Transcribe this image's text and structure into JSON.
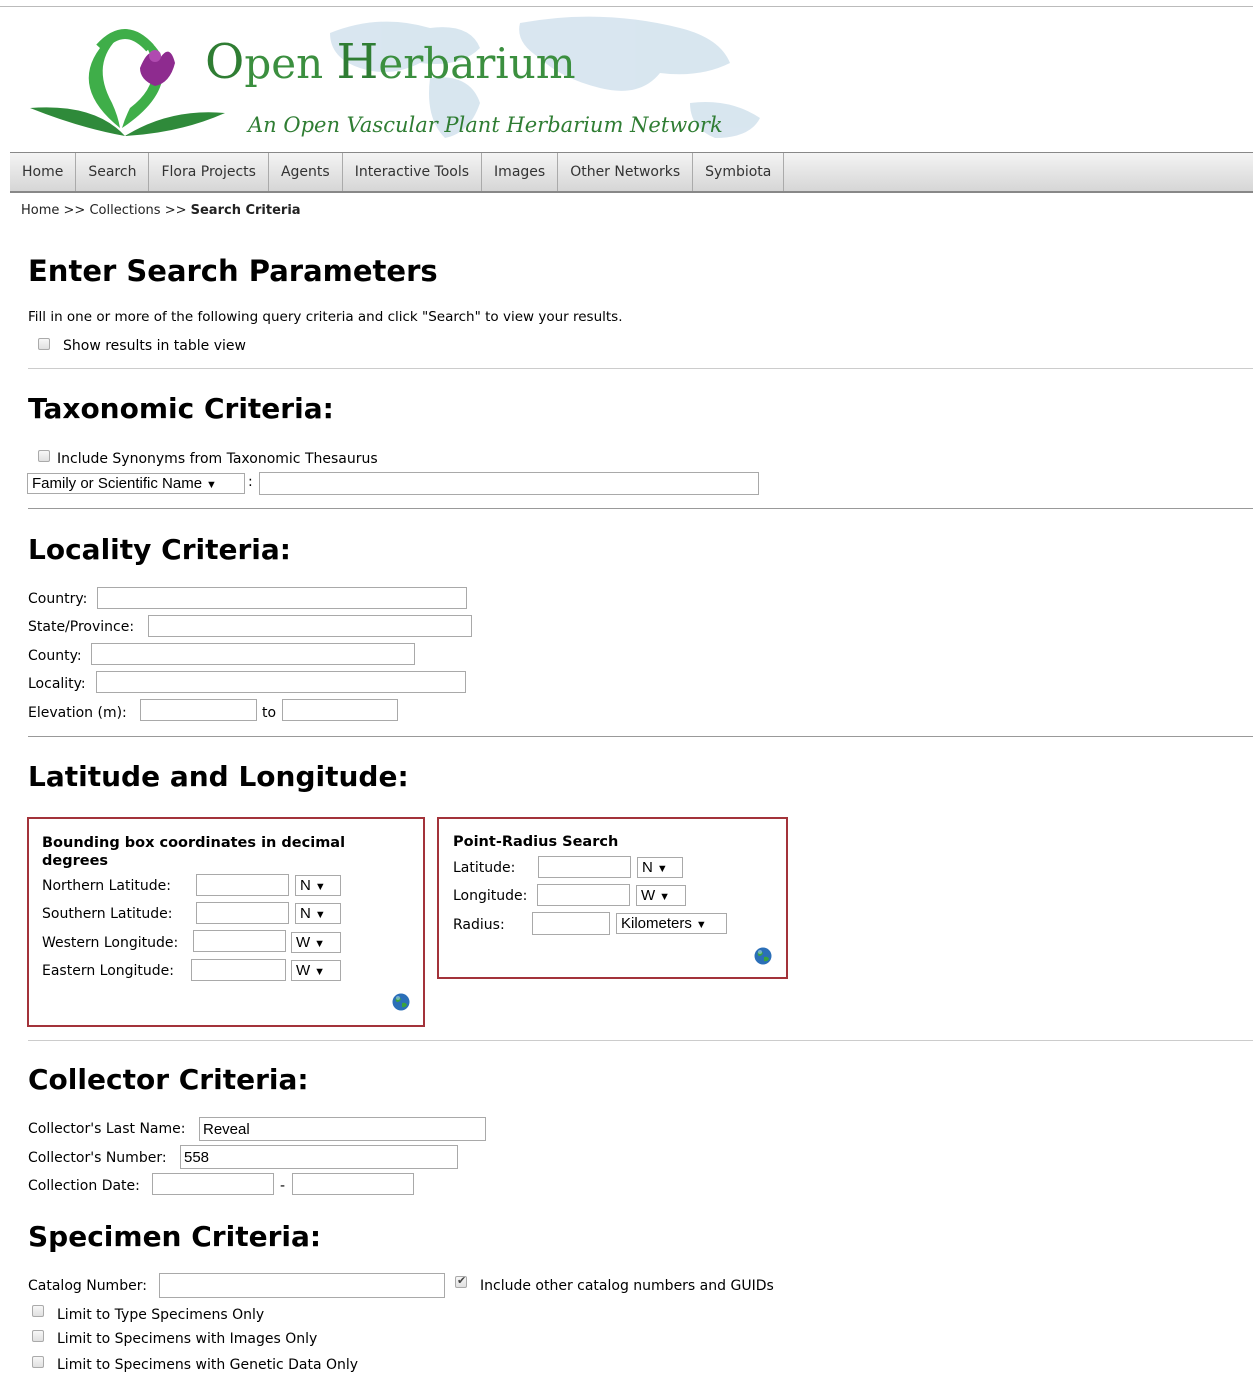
{
  "brand": {
    "title_o": "O",
    "title_rest1": "pen ",
    "title_h": "H",
    "title_rest2": "erbarium",
    "subtitle": "An Open Vascular Plant Herbarium Network"
  },
  "nav": [
    "Home",
    "Search",
    "Flora Projects",
    "Agents",
    "Interactive Tools",
    "Images",
    "Other Networks",
    "Symbiota"
  ],
  "breadcrumb": {
    "home": "Home",
    "sep": ">>",
    "collections": "Collections",
    "current": "Search Criteria"
  },
  "page_title": "Enter Search Parameters",
  "intro": "Fill in one or more of the following query criteria and click \"Search\" to view your results.",
  "table_view_label": "Show results in table view",
  "taxonomic": {
    "heading": "Taxonomic Criteria:",
    "synonyms_label": "Include Synonyms from Taxonomic Thesaurus",
    "type_select": "Family or Scientific Name",
    "colon": ":",
    "taxa_value": ""
  },
  "locality": {
    "heading": "Locality Criteria:",
    "country_label": "Country:",
    "state_label": "State/Province:",
    "county_label": "County:",
    "locality_label": "Locality:",
    "elevation_label": "Elevation (m):",
    "to_label": "to"
  },
  "latlong": {
    "heading": "Latitude and Longitude:",
    "bbox_title": "Bounding box coordinates in decimal degrees",
    "north_label": "Northern Latitude:",
    "south_label": "Southern Latitude:",
    "west_label": "Western Longitude:",
    "east_label": "Eastern Longitude:",
    "north_dir": "N",
    "south_dir": "N",
    "west_dir": "W",
    "east_dir": "W",
    "point_title": "Point-Radius Search",
    "lat_label": "Latitude:",
    "lng_label": "Longitude:",
    "radius_label": "Radius:",
    "lat_dir": "N",
    "lng_dir": "W",
    "radius_units": "Kilometers"
  },
  "collector": {
    "heading": "Collector Criteria:",
    "last_name_label": "Collector's Last Name:",
    "last_name_value": "Reveal",
    "number_label": "Collector's Number:",
    "number_value": "558",
    "date_label": "Collection Date:",
    "date_sep": "-"
  },
  "specimen": {
    "heading": "Specimen Criteria:",
    "catalog_label": "Catalog Number:",
    "other_catalog_label": "Include other catalog numbers and GUIDs",
    "type_only_label": "Limit to Type Specimens Only",
    "images_only_label": "Limit to Specimens with Images Only",
    "genetic_only_label": "Limit to Specimens with Genetic Data Only"
  },
  "colors": {
    "accent_border": "#a3333a",
    "brand_green": "#3b8f3f"
  }
}
